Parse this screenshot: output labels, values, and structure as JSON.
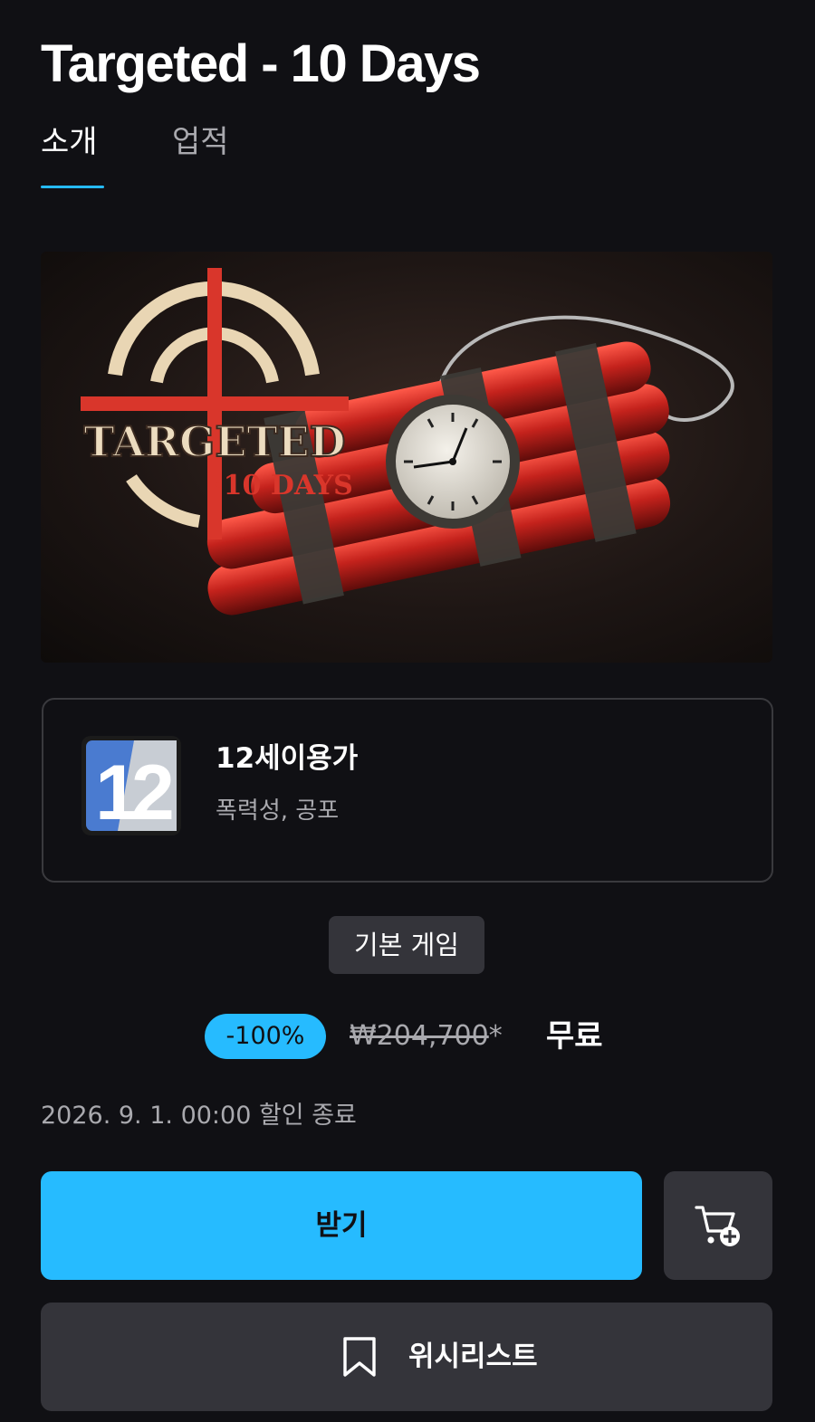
{
  "header": {
    "title": "Targeted - 10 Days"
  },
  "tabs": [
    {
      "label": "소개",
      "active": true
    },
    {
      "label": "업적",
      "active": false
    }
  ],
  "hero": {
    "logo_line1": "TARGETED",
    "logo_line2": "·10 DAYS"
  },
  "rating": {
    "badge_number": "12",
    "title": "12세이용가",
    "descriptors": "폭력성, 공포"
  },
  "tag": {
    "label": "기본 게임"
  },
  "price": {
    "discount": "-100%",
    "original": "₩204,700",
    "original_suffix": "*",
    "final": "무료"
  },
  "sale_end": "2026. 9. 1. 00:00 할인 종료",
  "actions": {
    "get_label": "받기",
    "cart_icon": "cart-plus-icon",
    "wishlist_icon": "bookmark-icon",
    "wishlist_label": "위시리스트"
  },
  "colors": {
    "accent": "#26bbff",
    "background": "#101014",
    "surface": "#34343a",
    "muted_text": "#a9a9ae"
  }
}
